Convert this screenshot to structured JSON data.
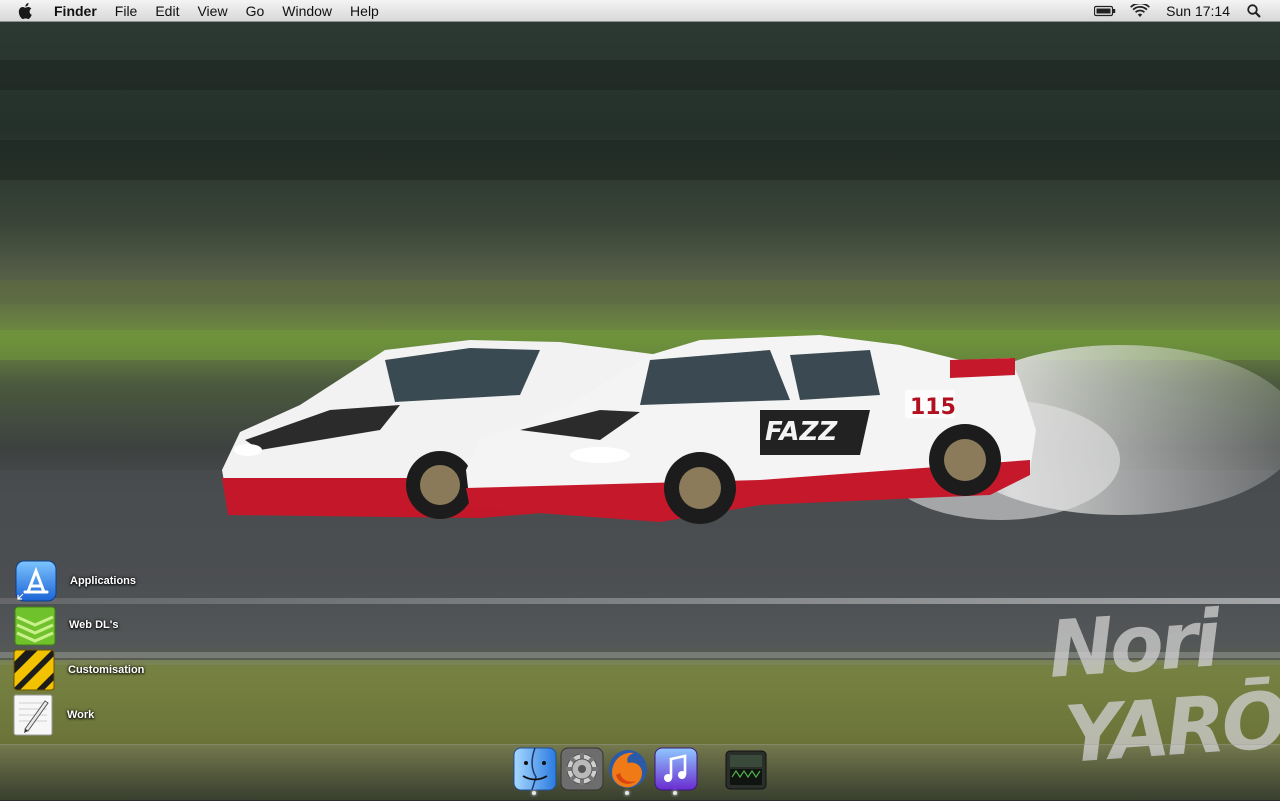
{
  "menubar": {
    "app_name": "Finder",
    "menus": [
      "File",
      "Edit",
      "View",
      "Go",
      "Window",
      "Help"
    ],
    "clock": "Sun 17:14"
  },
  "desktop": {
    "items": [
      {
        "label": "Applications",
        "icon": "app-store-icon"
      },
      {
        "label": "Web DL's",
        "icon": "green-stack-folder-icon"
      },
      {
        "label": "Customisation",
        "icon": "hazard-stripe-folder-icon"
      },
      {
        "label": "Work",
        "icon": "textedit-icon"
      }
    ]
  },
  "dock": {
    "items": [
      {
        "name": "Finder",
        "icon": "finder-icon",
        "running": true
      },
      {
        "name": "System Preferences",
        "icon": "system-preferences-icon",
        "running": false
      },
      {
        "name": "Firefox",
        "icon": "firefox-icon",
        "running": true
      },
      {
        "name": "iTunes",
        "icon": "itunes-icon",
        "running": true
      },
      {
        "name": "Downloads stack",
        "icon": "stack-icon",
        "running": false
      }
    ]
  },
  "wallpaper": {
    "car_numbers": [
      "115"
    ],
    "sponsor_text": "FAZZ",
    "watermark_line1": "Nori",
    "watermark_line2": "YARŌ"
  }
}
